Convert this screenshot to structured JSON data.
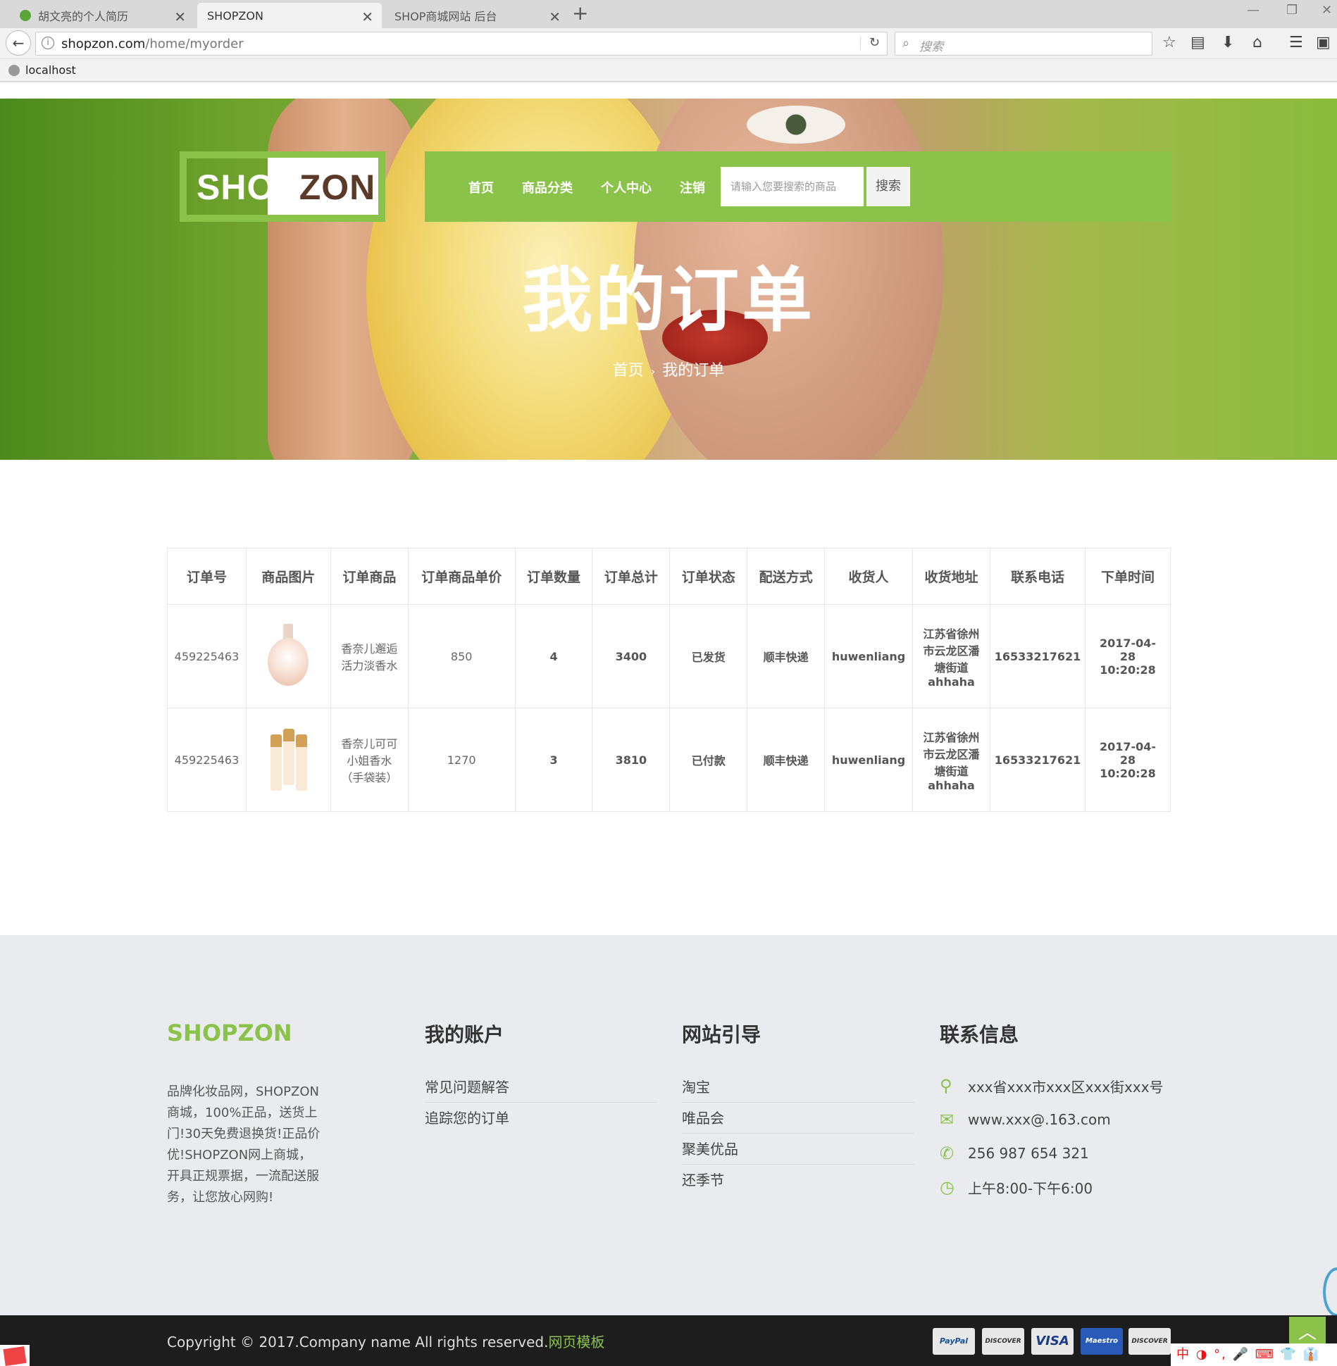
{
  "browser": {
    "tabs": [
      {
        "title": "胡文亮的个人简历",
        "active": false
      },
      {
        "title": "SHOPZON",
        "active": true
      },
      {
        "title": "SHOP商城网站 后台",
        "active": false
      }
    ],
    "url_host": "shopzon.com",
    "url_path": "/home/myorder",
    "search_placeholder": "搜索",
    "bookmark": "localhost"
  },
  "site": {
    "logo": {
      "light": "SHOP",
      "dark": "ZON"
    },
    "nav": [
      {
        "label": "首页"
      },
      {
        "label": "商品分类"
      },
      {
        "label": "个人中心"
      },
      {
        "label": "注销"
      }
    ],
    "search": {
      "placeholder": "请输入您要搜索的商品",
      "button": "搜索"
    },
    "hero_title": "我的订单",
    "breadcrumb": {
      "home": "首页",
      "sep": "›",
      "current": "我的订单"
    }
  },
  "orders": {
    "headers": [
      "订单号",
      "商品图片",
      "订单商品",
      "订单商品单价",
      "订单数量",
      "订单总计",
      "订单状态",
      "配送方式",
      "收货人",
      "收货地址",
      "联系电话",
      "下单时间"
    ],
    "rows": [
      {
        "order_no": "459225463",
        "image_icon": "perfume-bottle-icon",
        "product": "香奈儿邂逅活力淡香水",
        "unit_price": "850",
        "quantity": "4",
        "total": "3400",
        "status": "已发货",
        "shipping": "顺丰快递",
        "recipient": "huwenliang",
        "address": "江苏省徐州市云龙区潘塘街道ahhaha",
        "phone": "16533217621",
        "time": "2017-04-28 10:20:28"
      },
      {
        "order_no": "459225463",
        "image_icon": "perfume-set-icon",
        "product": "香奈儿可可小姐香水（手袋装）",
        "unit_price": "1270",
        "quantity": "3",
        "total": "3810",
        "status": "已付款",
        "shipping": "顺丰快递",
        "recipient": "huwenliang",
        "address": "江苏省徐州市云龙区潘塘街道ahhaha",
        "phone": "16533217621",
        "time": "2017-04-28 10:20:28"
      }
    ]
  },
  "footer": {
    "brand": "SHOPZON",
    "description": "品牌化妆品网，SHOPZON商城，100%正品，送货上门!30天免费退换货!正品价优!SHOPZON网上商城，开具正规票据，一流配送服务，让您放心网购!",
    "account": {
      "title": "我的账户",
      "links": [
        "常见问题解答",
        "追踪您的订单"
      ]
    },
    "guide": {
      "title": "网站引导",
      "links": [
        "淘宝",
        "唯品会",
        "聚美优品",
        "还季节"
      ]
    },
    "contact": {
      "title": "联系信息",
      "items": [
        {
          "icon": "location-pin-icon",
          "text": "xxx省xxx市xxx区xxx街xxx号"
        },
        {
          "icon": "envelope-icon",
          "text": "www.xxx@.163.com"
        },
        {
          "icon": "phone-icon",
          "text": "256 987 654 321"
        },
        {
          "icon": "clock-icon",
          "text": "上午8:00-下午6:00"
        }
      ]
    },
    "copyright": "Copyright © 2017.Company name All rights reserved.",
    "copyright_link": "网页模板",
    "payments": [
      "PayPal",
      "DISCOVER",
      "VISA",
      "Maestro",
      "DISCOVER"
    ]
  },
  "ime_text": "中 ◑ °, 🎤 ⌨ 👕 👔",
  "colors": {
    "accent": "#8bc34a",
    "footer_bg": "#e9ebef",
    "bottom_bar": "#1d1d1d"
  }
}
